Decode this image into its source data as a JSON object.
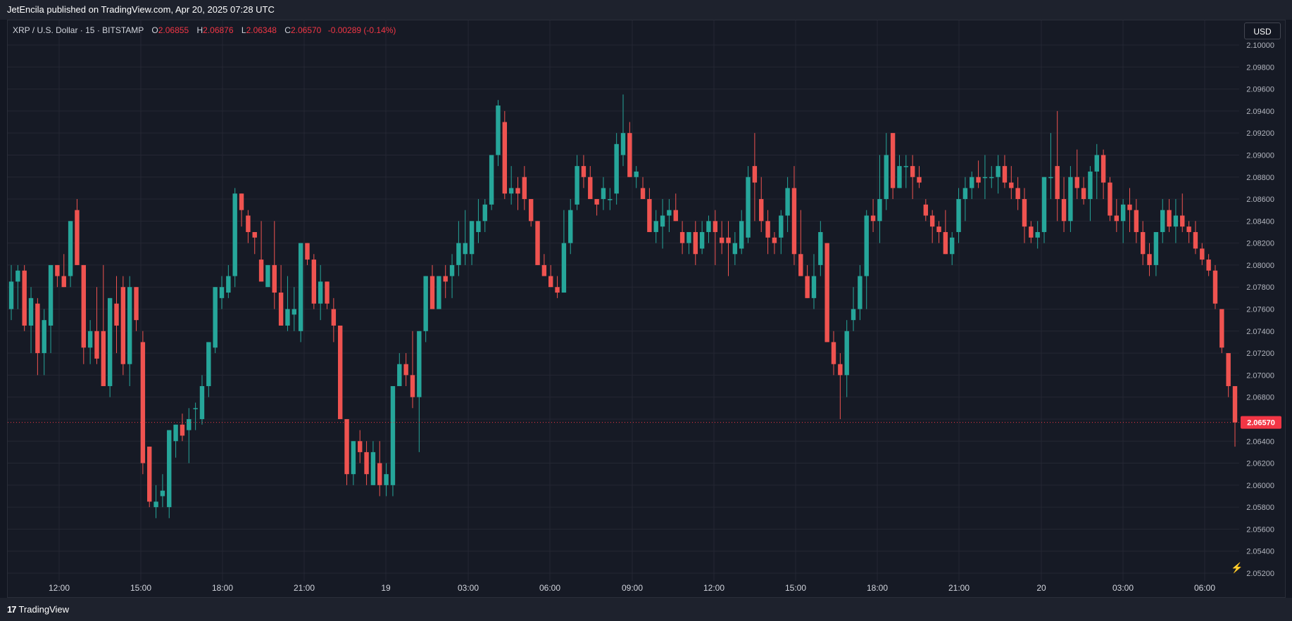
{
  "header": {
    "published_by": "JetEncila published on TradingView.com, Apr 20, 2025 07:28 UTC"
  },
  "legend": {
    "symbol": "XRP / U.S. Dollar · 15 · BITSTAMP",
    "open_label": "O",
    "open": "2.06855",
    "high_label": "H",
    "high": "2.06876",
    "low_label": "L",
    "low": "2.06348",
    "close_label": "C",
    "close": "2.06570",
    "change": "-0.00289 (-0.14%)"
  },
  "currency_button": "USD",
  "footer": {
    "brand": "TradingView",
    "brand_mark": "17"
  },
  "colors": {
    "up": "#26a69a",
    "down": "#ef5350",
    "background": "#161a25",
    "grid": "#242733",
    "last_price": "#f23645"
  },
  "chart_data": {
    "type": "candlestick",
    "ylim": [
      2.052,
      2.1
    ],
    "y_ticks": [
      "2.10000",
      "2.09800",
      "2.09600",
      "2.09400",
      "2.09200",
      "2.09000",
      "2.08800",
      "2.08600",
      "2.08400",
      "2.08200",
      "2.08000",
      "2.07800",
      "2.07600",
      "2.07400",
      "2.07200",
      "2.07000",
      "2.06800",
      "2.06570",
      "2.06400",
      "2.06200",
      "2.06000",
      "2.05800",
      "2.05600",
      "2.05400",
      "2.05200"
    ],
    "x_ticks": [
      "12:00",
      "15:00",
      "18:00",
      "21:00",
      "19",
      "03:00",
      "06:00",
      "09:00",
      "12:00",
      "15:00",
      "18:00",
      "21:00",
      "20",
      "03:00",
      "06:00"
    ],
    "last_price": 2.0657,
    "last_price_label": "2.06570",
    "candles": [
      [
        2.076,
        2.08,
        2.075,
        2.0785
      ],
      [
        2.0785,
        2.08,
        2.076,
        2.0795
      ],
      [
        2.0795,
        2.08,
        2.074,
        2.0745
      ],
      [
        2.0745,
        2.078,
        2.072,
        2.077
      ],
      [
        2.0765,
        2.077,
        2.07,
        2.072
      ],
      [
        2.072,
        2.076,
        2.07,
        2.075
      ],
      [
        2.0745,
        2.08,
        2.072,
        2.08
      ],
      [
        2.08,
        2.08,
        2.078,
        2.079
      ],
      [
        2.079,
        2.081,
        2.078,
        2.078
      ],
      [
        2.079,
        2.084,
        2.078,
        2.084
      ],
      [
        2.085,
        2.086,
        2.08,
        2.08
      ],
      [
        2.08,
        2.08,
        2.071,
        2.0725
      ],
      [
        2.0725,
        2.075,
        2.071,
        2.074
      ],
      [
        2.074,
        2.078,
        2.071,
        2.0715
      ],
      [
        2.074,
        2.08,
        2.069,
        2.069
      ],
      [
        2.069,
        2.077,
        2.068,
        2.077
      ],
      [
        2.0765,
        2.079,
        2.072,
        2.0745
      ],
      [
        2.078,
        2.079,
        2.07,
        2.071
      ],
      [
        2.071,
        2.079,
        2.069,
        2.078
      ],
      [
        2.078,
        2.076,
        2.074,
        2.075
      ],
      [
        2.073,
        2.074,
        2.061,
        2.062
      ],
      [
        2.0635,
        2.063,
        2.058,
        2.0585
      ],
      [
        2.058,
        2.06,
        2.057,
        2.0585
      ],
      [
        2.059,
        2.061,
        2.058,
        2.0595
      ],
      [
        2.058,
        2.062,
        2.057,
        2.065
      ],
      [
        2.064,
        2.0655,
        2.0625,
        2.0655
      ],
      [
        2.0655,
        2.0665,
        2.064,
        2.0645
      ],
      [
        2.065,
        2.067,
        2.062,
        2.066
      ],
      [
        2.067,
        2.0675,
        2.065,
        2.067
      ],
      [
        2.066,
        2.07,
        2.0655,
        2.069
      ],
      [
        2.069,
        2.073,
        2.068,
        2.073
      ],
      [
        2.0725,
        2.078,
        2.072,
        2.078
      ],
      [
        2.077,
        2.079,
        2.076,
        2.078
      ],
      [
        2.0775,
        2.08,
        2.077,
        2.079
      ],
      [
        2.079,
        2.087,
        2.078,
        2.0865
      ],
      [
        2.0865,
        2.0855,
        2.0835,
        2.085
      ],
      [
        2.0845,
        2.085,
        2.082,
        2.083
      ],
      [
        2.083,
        2.0825,
        2.081,
        2.0825
      ],
      [
        2.0805,
        2.084,
        2.0785,
        2.0785
      ],
      [
        2.078,
        2.08,
        2.078,
        2.08
      ],
      [
        2.08,
        2.084,
        2.076,
        2.0775
      ],
      [
        2.0775,
        2.08,
        2.075,
        2.0745
      ],
      [
        2.0745,
        2.079,
        2.074,
        2.076
      ],
      [
        2.0755,
        2.078,
        2.074,
        2.076
      ],
      [
        2.074,
        2.0775,
        2.073,
        2.082
      ],
      [
        2.082,
        2.0815,
        2.08,
        2.0805
      ],
      [
        2.0805,
        2.081,
        2.076,
        2.0765
      ],
      [
        2.0765,
        2.08,
        2.075,
        2.0785
      ],
      [
        2.0785,
        2.077,
        2.076,
        2.0765
      ],
      [
        2.076,
        2.077,
        2.073,
        2.0745
      ],
      [
        2.0745,
        2.0745,
        2.066,
        2.066
      ],
      [
        2.066,
        2.065,
        2.06,
        2.061
      ],
      [
        2.061,
        2.064,
        2.06,
        2.064
      ],
      [
        2.064,
        2.065,
        2.062,
        2.063
      ],
      [
        2.063,
        2.064,
        2.06,
        2.061
      ],
      [
        2.06,
        2.064,
        2.06,
        2.063
      ],
      [
        2.062,
        2.064,
        2.059,
        2.06
      ],
      [
        2.06,
        2.062,
        2.059,
        2.061
      ],
      [
        2.06,
        2.069,
        2.059,
        2.069
      ],
      [
        2.069,
        2.072,
        2.069,
        2.071
      ],
      [
        2.071,
        2.072,
        2.069,
        2.07
      ],
      [
        2.07,
        2.074,
        2.067,
        2.068
      ],
      [
        2.068,
        2.074,
        2.063,
        2.074
      ],
      [
        2.074,
        2.079,
        2.073,
        2.079
      ],
      [
        2.079,
        2.08,
        2.077,
        2.076
      ],
      [
        2.076,
        2.079,
        2.076,
        2.079
      ],
      [
        2.079,
        2.08,
        2.077,
        2.0785
      ],
      [
        2.079,
        2.081,
        2.077,
        2.08
      ],
      [
        2.08,
        2.084,
        2.079,
        2.082
      ],
      [
        2.081,
        2.085,
        2.08,
        2.082
      ],
      [
        2.081,
        2.084,
        2.08,
        2.084
      ],
      [
        2.083,
        2.086,
        2.082,
        2.084
      ],
      [
        2.084,
        2.086,
        2.083,
        2.0855
      ],
      [
        2.0855,
        2.09,
        2.085,
        2.09
      ],
      [
        2.09,
        2.095,
        2.089,
        2.0945
      ],
      [
        2.093,
        2.094,
        2.086,
        2.0865
      ],
      [
        2.0865,
        2.089,
        2.0855,
        2.087
      ],
      [
        2.087,
        2.088,
        2.085,
        2.0865
      ],
      [
        2.088,
        2.089,
        2.085,
        2.086
      ],
      [
        2.086,
        2.086,
        2.0835,
        2.084
      ],
      [
        2.084,
        2.084,
        2.08,
        2.08
      ],
      [
        2.08,
        2.081,
        2.079,
        2.079
      ],
      [
        2.079,
        2.08,
        2.078,
        2.078
      ],
      [
        2.078,
        2.079,
        2.077,
        2.0775
      ],
      [
        2.0775,
        2.085,
        2.0775,
        2.082
      ],
      [
        2.082,
        2.086,
        2.081,
        2.085
      ],
      [
        2.0855,
        2.09,
        2.085,
        2.089
      ],
      [
        2.089,
        2.09,
        2.087,
        2.088
      ],
      [
        2.088,
        2.089,
        2.086,
        2.086
      ],
      [
        2.086,
        2.086,
        2.0845,
        2.0855
      ],
      [
        2.086,
        2.088,
        2.085,
        2.087
      ],
      [
        2.086,
        2.087,
        2.085,
        2.086
      ],
      [
        2.0865,
        2.092,
        2.0855,
        2.091
      ],
      [
        2.09,
        2.0955,
        2.089,
        2.092
      ],
      [
        2.092,
        2.093,
        2.088,
        2.088
      ],
      [
        2.088,
        2.089,
        2.087,
        2.0885
      ],
      [
        2.087,
        2.088,
        2.086,
        2.086
      ],
      [
        2.086,
        2.087,
        2.083,
        2.083
      ],
      [
        2.083,
        2.085,
        2.082,
        2.084
      ],
      [
        2.0835,
        2.086,
        2.0815,
        2.0845
      ],
      [
        2.0845,
        2.086,
        2.083,
        2.085
      ],
      [
        2.085,
        2.0865,
        2.084,
        2.084
      ],
      [
        2.083,
        2.084,
        2.081,
        2.082
      ],
      [
        2.082,
        2.083,
        2.081,
        2.083
      ],
      [
        2.083,
        2.084,
        2.08,
        2.081
      ],
      [
        2.0815,
        2.084,
        2.081,
        2.083
      ],
      [
        2.083,
        2.0845,
        2.082,
        2.084
      ],
      [
        2.084,
        2.085,
        2.08,
        2.083
      ],
      [
        2.0825,
        2.084,
        2.081,
        2.082
      ],
      [
        2.0825,
        2.084,
        2.079,
        2.082
      ],
      [
        2.081,
        2.083,
        2.08,
        2.082
      ],
      [
        2.0815,
        2.085,
        2.081,
        2.084
      ],
      [
        2.0825,
        2.089,
        2.082,
        2.088
      ],
      [
        2.089,
        2.092,
        2.084,
        2.0875
      ],
      [
        2.086,
        2.088,
        2.083,
        2.084
      ],
      [
        2.084,
        2.085,
        2.081,
        2.0825
      ],
      [
        2.0825,
        2.083,
        2.081,
        2.082
      ],
      [
        2.0825,
        2.085,
        2.081,
        2.0845
      ],
      [
        2.0845,
        2.088,
        2.083,
        2.087
      ],
      [
        2.087,
        2.089,
        2.08,
        2.081
      ],
      [
        2.081,
        2.085,
        2.079,
        2.079
      ],
      [
        2.079,
        2.08,
        2.078,
        2.077
      ],
      [
        2.077,
        2.081,
        2.076,
        2.079
      ],
      [
        2.08,
        2.084,
        2.079,
        2.083
      ],
      [
        2.082,
        2.079,
        2.078,
        2.073
      ],
      [
        2.073,
        2.074,
        2.07,
        2.071
      ],
      [
        2.071,
        2.072,
        2.066,
        2.07
      ],
      [
        2.07,
        2.075,
        2.068,
        2.074
      ],
      [
        2.075,
        2.078,
        2.074,
        2.076
      ],
      [
        2.076,
        2.08,
        2.075,
        2.079
      ],
      [
        2.079,
        2.085,
        2.076,
        2.0845
      ],
      [
        2.0845,
        2.086,
        2.083,
        2.084
      ],
      [
        2.084,
        2.09,
        2.082,
        2.086
      ],
      [
        2.086,
        2.092,
        2.085,
        2.09
      ],
      [
        2.092,
        2.092,
        2.086,
        2.087
      ],
      [
        2.087,
        2.09,
        2.087,
        2.089
      ],
      [
        2.089,
        2.09,
        2.087,
        2.089
      ],
      [
        2.089,
        2.09,
        2.086,
        2.088
      ],
      [
        2.088,
        2.089,
        2.087,
        2.0875
      ],
      [
        2.0855,
        2.086,
        2.084,
        2.0845
      ],
      [
        2.0845,
        2.085,
        2.082,
        2.0835
      ],
      [
        2.0835,
        2.084,
        2.082,
        2.083
      ],
      [
        2.083,
        2.085,
        2.081,
        2.081
      ],
      [
        2.081,
        2.083,
        2.08,
        2.0825
      ],
      [
        2.083,
        2.087,
        2.082,
        2.086
      ],
      [
        2.086,
        2.088,
        2.084,
        2.087
      ],
      [
        2.087,
        2.0885,
        2.086,
        2.088
      ],
      [
        2.088,
        2.0895,
        2.087,
        2.0875
      ],
      [
        2.088,
        2.09,
        2.086,
        2.088
      ],
      [
        2.088,
        2.089,
        2.087,
        2.088
      ],
      [
        2.088,
        2.09,
        2.0865,
        2.089
      ],
      [
        2.089,
        2.09,
        2.087,
        2.0875
      ],
      [
        2.0875,
        2.089,
        2.086,
        2.087
      ],
      [
        2.087,
        2.088,
        2.085,
        2.086
      ],
      [
        2.086,
        2.087,
        2.082,
        2.0835
      ],
      [
        2.0835,
        2.084,
        2.082,
        2.0825
      ],
      [
        2.0825,
        2.084,
        2.0815,
        2.083
      ],
      [
        2.083,
        2.088,
        2.082,
        2.088
      ],
      [
        2.088,
        2.092,
        2.086,
        2.088
      ],
      [
        2.089,
        2.094,
        2.084,
        2.086
      ],
      [
        2.086,
        2.088,
        2.083,
        2.084
      ],
      [
        2.084,
        2.089,
        2.083,
        2.088
      ],
      [
        2.088,
        2.0905,
        2.086,
        2.087
      ],
      [
        2.087,
        2.088,
        2.0855,
        2.086
      ],
      [
        2.086,
        2.089,
        2.084,
        2.0885
      ],
      [
        2.0885,
        2.091,
        2.086,
        2.09
      ],
      [
        2.09,
        2.0905,
        2.086,
        2.0875
      ],
      [
        2.0875,
        2.088,
        2.084,
        2.0845
      ],
      [
        2.0845,
        2.086,
        2.083,
        2.084
      ],
      [
        2.084,
        2.086,
        2.082,
        2.0855
      ],
      [
        2.0855,
        2.087,
        2.083,
        2.085
      ],
      [
        2.085,
        2.086,
        2.082,
        2.083
      ],
      [
        2.083,
        2.084,
        2.08,
        2.081
      ],
      [
        2.081,
        2.082,
        2.079,
        2.08
      ],
      [
        2.08,
        2.083,
        2.079,
        2.083
      ],
      [
        2.083,
        2.086,
        2.082,
        2.085
      ],
      [
        2.085,
        2.086,
        2.083,
        2.0835
      ],
      [
        2.0835,
        2.086,
        2.082,
        2.0845
      ],
      [
        2.0845,
        2.0865,
        2.083,
        2.0835
      ],
      [
        2.0835,
        2.084,
        2.082,
        2.083
      ],
      [
        2.083,
        2.084,
        2.081,
        2.0815
      ],
      [
        2.0815,
        2.082,
        2.08,
        2.0805
      ],
      [
        2.0805,
        2.081,
        2.079,
        2.0795
      ],
      [
        2.0795,
        2.08,
        2.076,
        2.0765
      ],
      [
        2.076,
        2.0755,
        2.072,
        2.0725
      ],
      [
        2.072,
        2.0715,
        2.068,
        2.069
      ],
      [
        2.069,
        2.0688,
        2.0635,
        2.0657
      ]
    ]
  }
}
